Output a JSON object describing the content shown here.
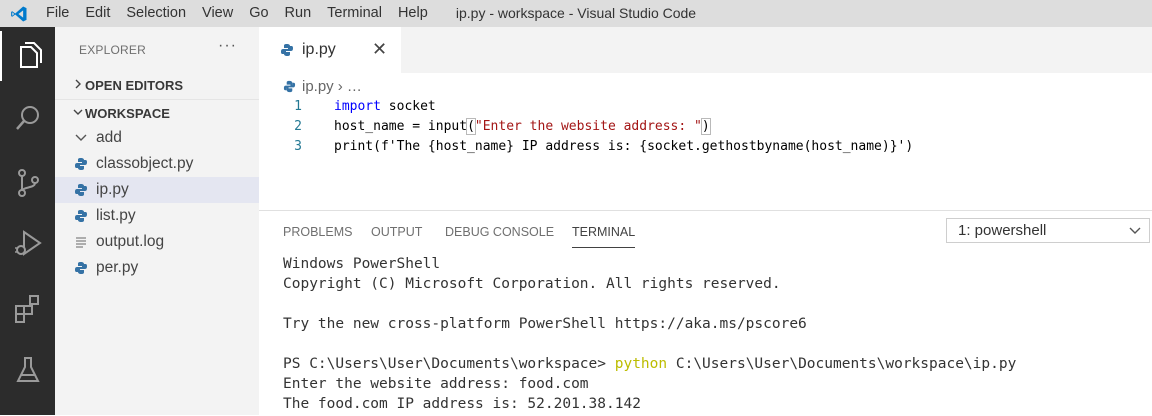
{
  "window": {
    "title": "ip.py - workspace - Visual Studio Code"
  },
  "menu": [
    "File",
    "Edit",
    "Selection",
    "View",
    "Go",
    "Run",
    "Terminal",
    "Help"
  ],
  "activity_bar": [
    "explorer-icon",
    "search-icon",
    "source-control-icon",
    "run-debug-icon",
    "extensions-icon",
    "testing-icon"
  ],
  "sidebar": {
    "header": "EXPLORER",
    "more": "···",
    "open_editors": "OPEN EDITORS",
    "workspace": "WORKSPACE",
    "items": [
      {
        "label": "add",
        "kind": "folder"
      },
      {
        "label": "classobject.py",
        "kind": "python"
      },
      {
        "label": "ip.py",
        "kind": "python",
        "selected": true
      },
      {
        "label": "list.py",
        "kind": "python"
      },
      {
        "label": "output.log",
        "kind": "log"
      },
      {
        "label": "per.py",
        "kind": "python"
      }
    ]
  },
  "editor": {
    "tab": {
      "label": "ip.py",
      "close": "✕"
    },
    "breadcrumb": {
      "file": "ip.py",
      "rest": "› …"
    },
    "line_numbers": [
      "1",
      "2",
      "3"
    ],
    "code": {
      "l1_kw": "import",
      "l1_rest": " socket",
      "l2_a": "host_name = input",
      "l2_paren_open": "(",
      "l2_str": "\"Enter the website address: \"",
      "l2_paren_close": ")",
      "l3": "print(f'The {host_name} IP address is: {socket.gethostbyname(host_name)}')"
    }
  },
  "panel": {
    "tabs": [
      "PROBLEMS",
      "OUTPUT",
      "DEBUG CONSOLE",
      "TERMINAL"
    ],
    "active_tab": "TERMINAL",
    "terminal_select": "1: powershell",
    "terminal": {
      "l1": "Windows PowerShell",
      "l2": "Copyright (C) Microsoft Corporation. All rights reserved.",
      "l3": "",
      "l4": "Try the new cross-platform PowerShell https://aka.ms/pscore6",
      "l5": "",
      "l6_prompt": "PS C:\\Users\\User\\Documents\\workspace> ",
      "l6_cmd": "python",
      "l6_arg": " C:\\Users\\User\\Documents\\workspace\\ip.py",
      "l7": "Enter the website address: food.com",
      "l8": "The food.com IP address is: 52.201.38.142"
    }
  },
  "colors": {
    "accent": "#007acc",
    "activity_bar": "#2c2c2c",
    "sidebar": "#f3f3f3",
    "selected_row": "#e4e6f1",
    "keyword": "#0000ff",
    "string": "#a31515"
  }
}
